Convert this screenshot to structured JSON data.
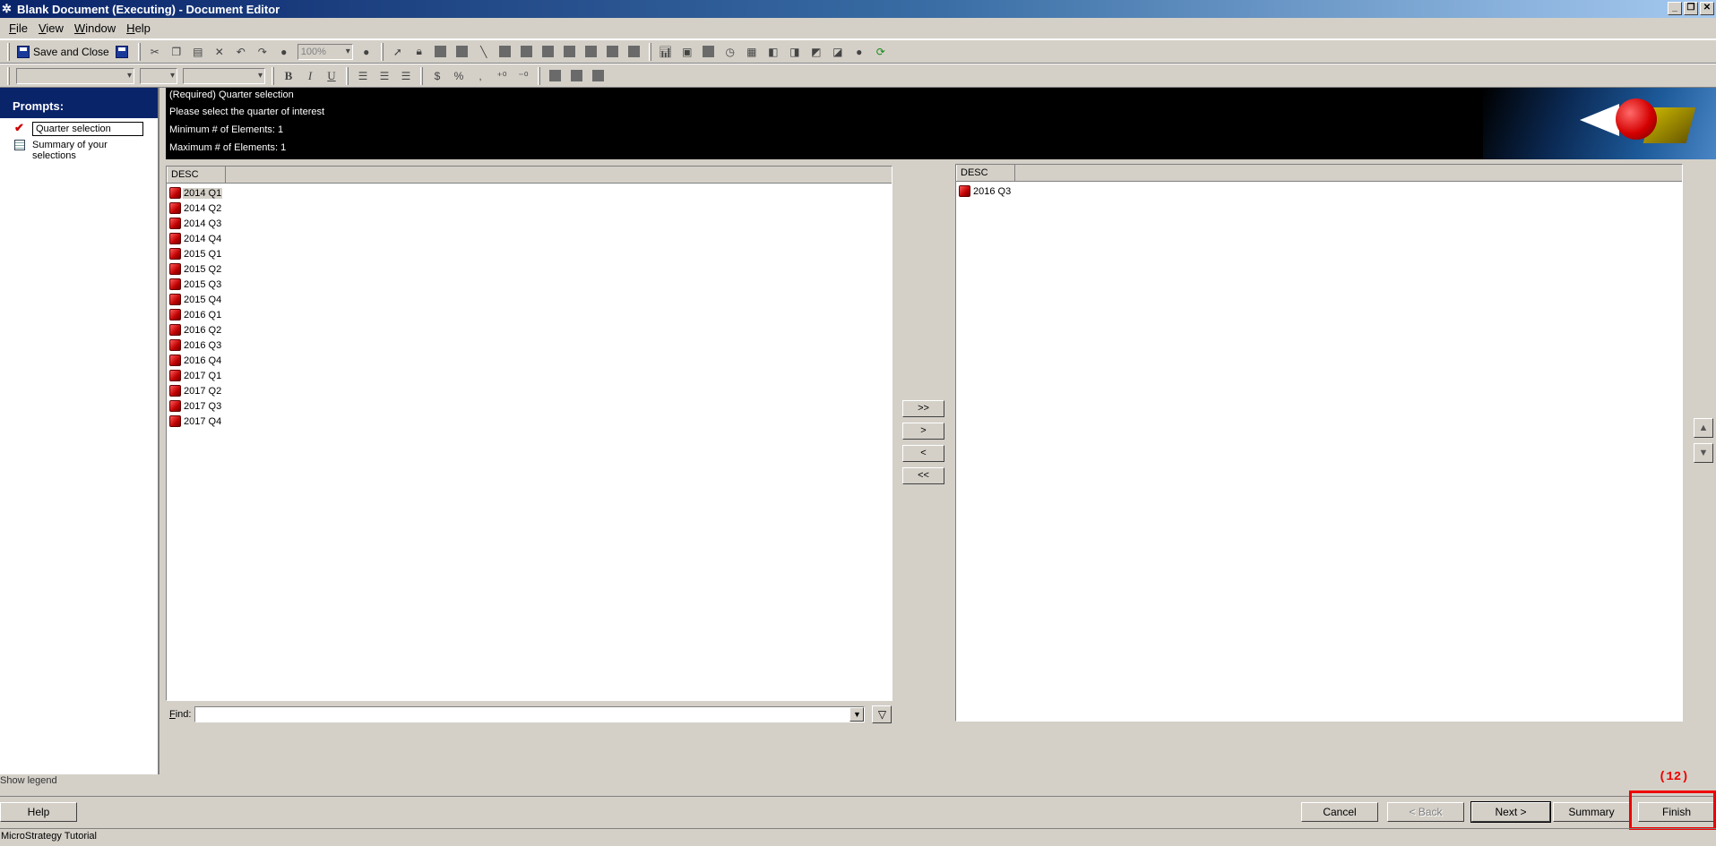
{
  "window": {
    "title": "Blank Document (Executing) - Document Editor",
    "controls": [
      "_",
      "❐",
      "✕"
    ]
  },
  "menu": [
    {
      "label": "File"
    },
    {
      "label": "View"
    },
    {
      "label": "Window"
    },
    {
      "label": "Help"
    }
  ],
  "toolbar": {
    "save_close": "Save and Close",
    "zoom": "100%"
  },
  "prompts": {
    "title": "Prompts:",
    "items": [
      {
        "label": "Quarter selection",
        "icon": "check-icon"
      },
      {
        "label": "Summary of your selections",
        "icon": "list-icon"
      }
    ],
    "show_legend": "Show legend"
  },
  "header": {
    "lines": [
      "(Required) Quarter selection",
      "Please select the quarter of interest",
      "Minimum # of Elements: 1",
      "Maximum # of Elements: 1"
    ]
  },
  "available": {
    "column": "DESC",
    "items": [
      "2014 Q1",
      "2014 Q2",
      "2014 Q3",
      "2014 Q4",
      "2015 Q1",
      "2015 Q2",
      "2015 Q3",
      "2015 Q4",
      "2016 Q1",
      "2016 Q2",
      "2016 Q3",
      "2016 Q4",
      "2017 Q1",
      "2017 Q2",
      "2017 Q3",
      "2017 Q4"
    ]
  },
  "selected": {
    "column": "DESC",
    "items": [
      "2016 Q3"
    ]
  },
  "find": {
    "label": "Find:",
    "value": ""
  },
  "movers": {
    "add_all": ">>",
    "add": ">",
    "remove": "<",
    "remove_all": "<<"
  },
  "buttons": {
    "help": "Help",
    "cancel": "Cancel",
    "back": "< Back",
    "next": "Next >",
    "summary": "Summary",
    "finish": "Finish"
  },
  "annotation": "(12)",
  "status": "MicroStrategy Tutorial"
}
